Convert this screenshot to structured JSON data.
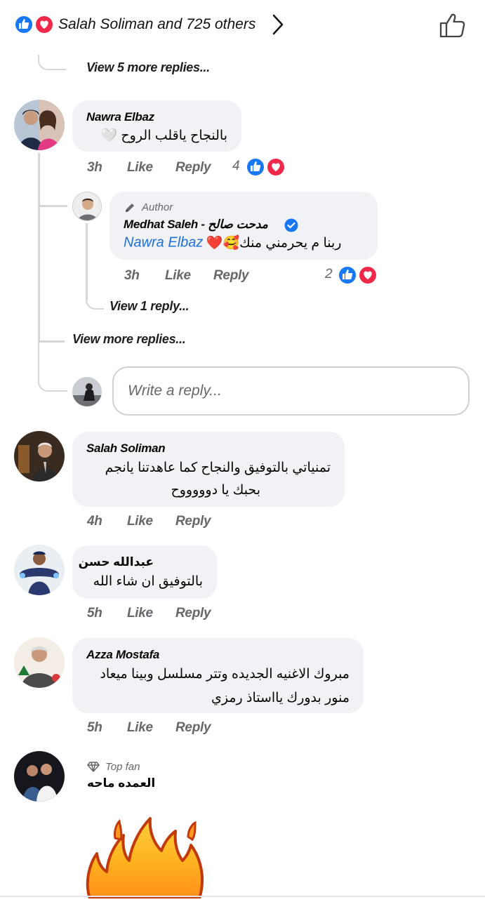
{
  "header": {
    "reactions_text": "Salah Soliman and 725 others",
    "icons": [
      "like-reaction-icon",
      "love-reaction-icon",
      "chevron-right-icon",
      "thumbs-up-outline-icon"
    ]
  },
  "thread": {
    "view_5_more": "View 5 more replies...",
    "comments": [
      {
        "name": "Nawra Elbaz",
        "text": "بالنجاح ياقلب الروح 🤍",
        "time": "3h",
        "like": "Like",
        "reply": "Reply",
        "reactions": "4"
      },
      {
        "badge": "Author",
        "name": "Medhat Saleh - مدحت صالح",
        "mention": "Nawra Elbaz",
        "text": "ربنا م يحرمني منك🥰❤️",
        "time": "3h",
        "like": "Like",
        "reply": "Reply",
        "reactions": "2"
      },
      {
        "name": "Salah Soliman",
        "line1": "تمنياتي بالتوفيق والنجاح كما عاهدتنا يانجم",
        "line2": "بحبك يا دوووووح",
        "time": "4h",
        "like": "Like",
        "reply": "Reply"
      },
      {
        "name": "عبدالله حسن",
        "text": "بالتوفيق ان شاء الله",
        "time": "5h",
        "like": "Like",
        "reply": "Reply"
      },
      {
        "name": "Azza Mostafa",
        "line1": "مبروك الاغنيه الجديده وتتر مسلسل وبينا ميعاد",
        "line2": "منور بدورك يااستاذ رمزي",
        "time": "5h",
        "like": "Like",
        "reply": "Reply"
      },
      {
        "badge": "Top fan",
        "name": "العمده ماحه"
      }
    ],
    "view_1_reply": "View 1 reply...",
    "view_more": "View more replies...",
    "reply_placeholder": "Write a reply..."
  },
  "colors": {
    "like_blue": "#1877f2",
    "love_red": "#f02849",
    "bubble_bg": "#f0f2f5",
    "meta_gray": "#65676b",
    "mention_blue": "#216fdb",
    "verified_blue": "#1877f2"
  }
}
